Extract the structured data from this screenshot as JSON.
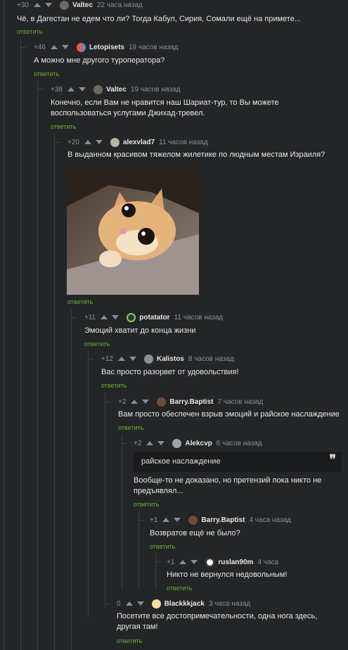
{
  "comments": [
    {
      "rating": "+30",
      "user": "Valtec",
      "time": "22 часа назад",
      "text": "Чё, в Дагестан не едем что ли? Тогда Кабул, Сирия, Сомали ещё на примете...",
      "reply": "ответить"
    },
    {
      "rating": "+46",
      "user": "Letopisets",
      "time": "19 часов назад",
      "text": "А можно мне другого туроператора?",
      "reply": "ответить"
    },
    {
      "rating": "+38",
      "user": "Valtec",
      "time": "19 часов назад",
      "text": "Конечно, если Вам не нравится наш Шариат-тур, то Вы можете воспользоваться услугами Джихад-тревел.",
      "reply": "ответить"
    },
    {
      "rating": "+20",
      "user": "alexvlad7",
      "time": "11 часов назад",
      "text": "В выданном красивом тяжелом жилетике по людным местам Израиля?",
      "reply": "ответить"
    },
    {
      "rating": "+11",
      "user": "potatator",
      "time": "11 часов назад",
      "text": "Эмоций хватит до конца жизни",
      "reply": "ответить"
    },
    {
      "rating": "+12",
      "user": "Kalistos",
      "time": "8 часов назад",
      "text": "Вас просто разорвет от удовольствия!",
      "reply": "ответить"
    },
    {
      "rating": "+2",
      "user": "Barry.Baptist",
      "time": "7 часов назад",
      "text": "Вам просто обеспечен взрыв эмоций и райское наслаждение",
      "reply": "ответить"
    },
    {
      "rating": "+2",
      "user": "Alekcvp",
      "time": "6 часов назад",
      "quote": "райское наслаждение",
      "text": "Вообще-то не доказано, но претензий пока никто не предъявлял...",
      "reply": "ответить"
    },
    {
      "rating": "+1",
      "user": "Barry.Baptist",
      "time": "4 часа назад",
      "text": "Возвратов ещё не было?",
      "reply": "ответить"
    },
    {
      "rating": "+1",
      "user": "ruslan90m",
      "time": "4 часа",
      "text": "Никто не вернулся недовольным!",
      "reply": "ответить"
    },
    {
      "rating": "0",
      "user": "Blackkkjack",
      "time": "3 часа назад",
      "text": "Посетите все достопримечательности, одна нога здесь, другая там!",
      "reply": "ответить"
    }
  ],
  "colors": {
    "background": "#232527",
    "reply": "#6fae3f",
    "text": "#e8e8e8",
    "meta": "#8f9296"
  }
}
